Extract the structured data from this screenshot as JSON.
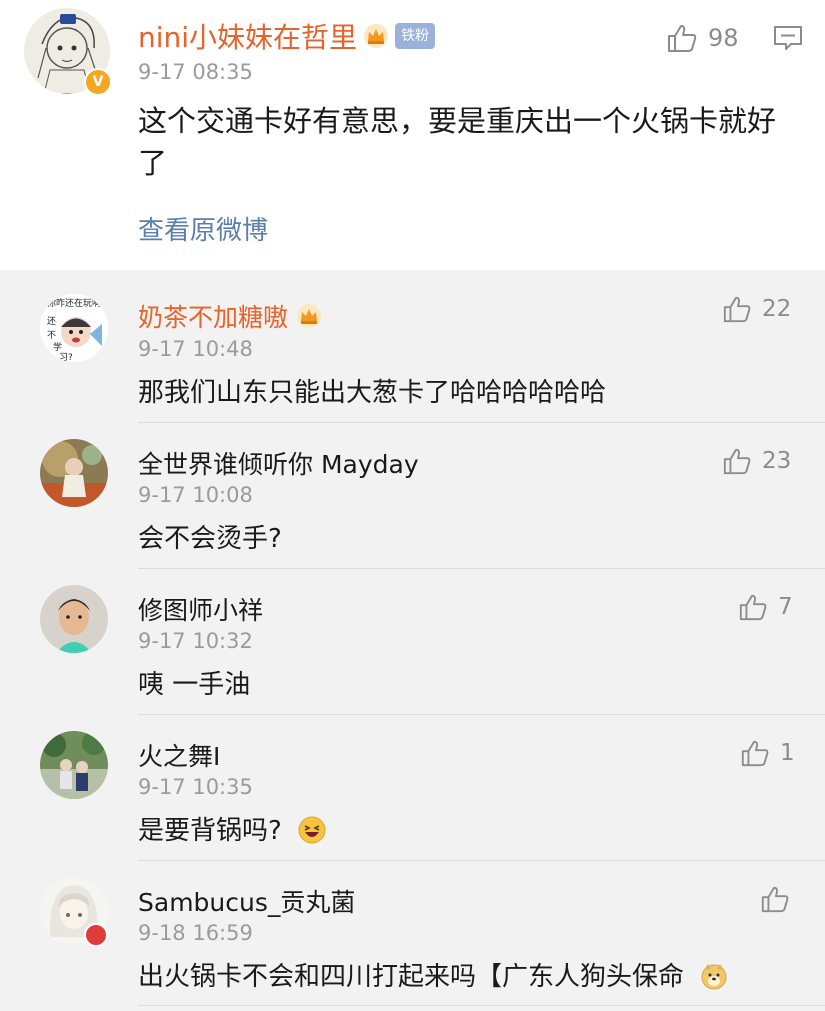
{
  "main_comment": {
    "username": "nini小妹妹在哲里",
    "fan_badge": "铁粉",
    "timestamp": "9-17 08:35",
    "text": "这个交通卡好有意思，要是重庆出一个火锅卡就好了",
    "view_original": "查看原微博",
    "likes": "98"
  },
  "replies": [
    {
      "username": "奶茶不加糖嗷",
      "timestamp": "9-17 10:48",
      "text": "那我们山东只能出大葱卡了哈哈哈哈哈哈",
      "likes": "22"
    },
    {
      "username": "全世界谁倾听你 Mayday",
      "timestamp": "9-17 10:08",
      "text": "会不会烫手?",
      "likes": "23"
    },
    {
      "username": "修图师小祥",
      "timestamp": "9-17 10:32",
      "text": "咦 一手油",
      "likes": "7"
    },
    {
      "username": "火之舞I",
      "timestamp": "9-17 10:35",
      "text": "是要背锅吗?",
      "likes": "1"
    },
    {
      "username": "Sambucus_贡丸菌",
      "timestamp": "9-18 16:59",
      "text": "出火锅卡不会和四川打起来吗【广东人狗头保命",
      "likes": ""
    }
  ],
  "avatar_texts": {
    "reply0": [
      "你咋还在玩啊",
      "还",
      "不",
      "学",
      "习?"
    ]
  },
  "colors": {
    "username_orange": "#e8632b",
    "link_blue": "#5b7fac",
    "fan_badge_bg": "#9bb2d8",
    "reply_bg": "#f2f2f2",
    "timestamp_gray": "#9b9b9b"
  },
  "icons": {
    "like": "thumbs-up-icon",
    "reply": "comment-bubble-icon",
    "crown": "crown-icon",
    "verified": "verified-v-icon"
  }
}
